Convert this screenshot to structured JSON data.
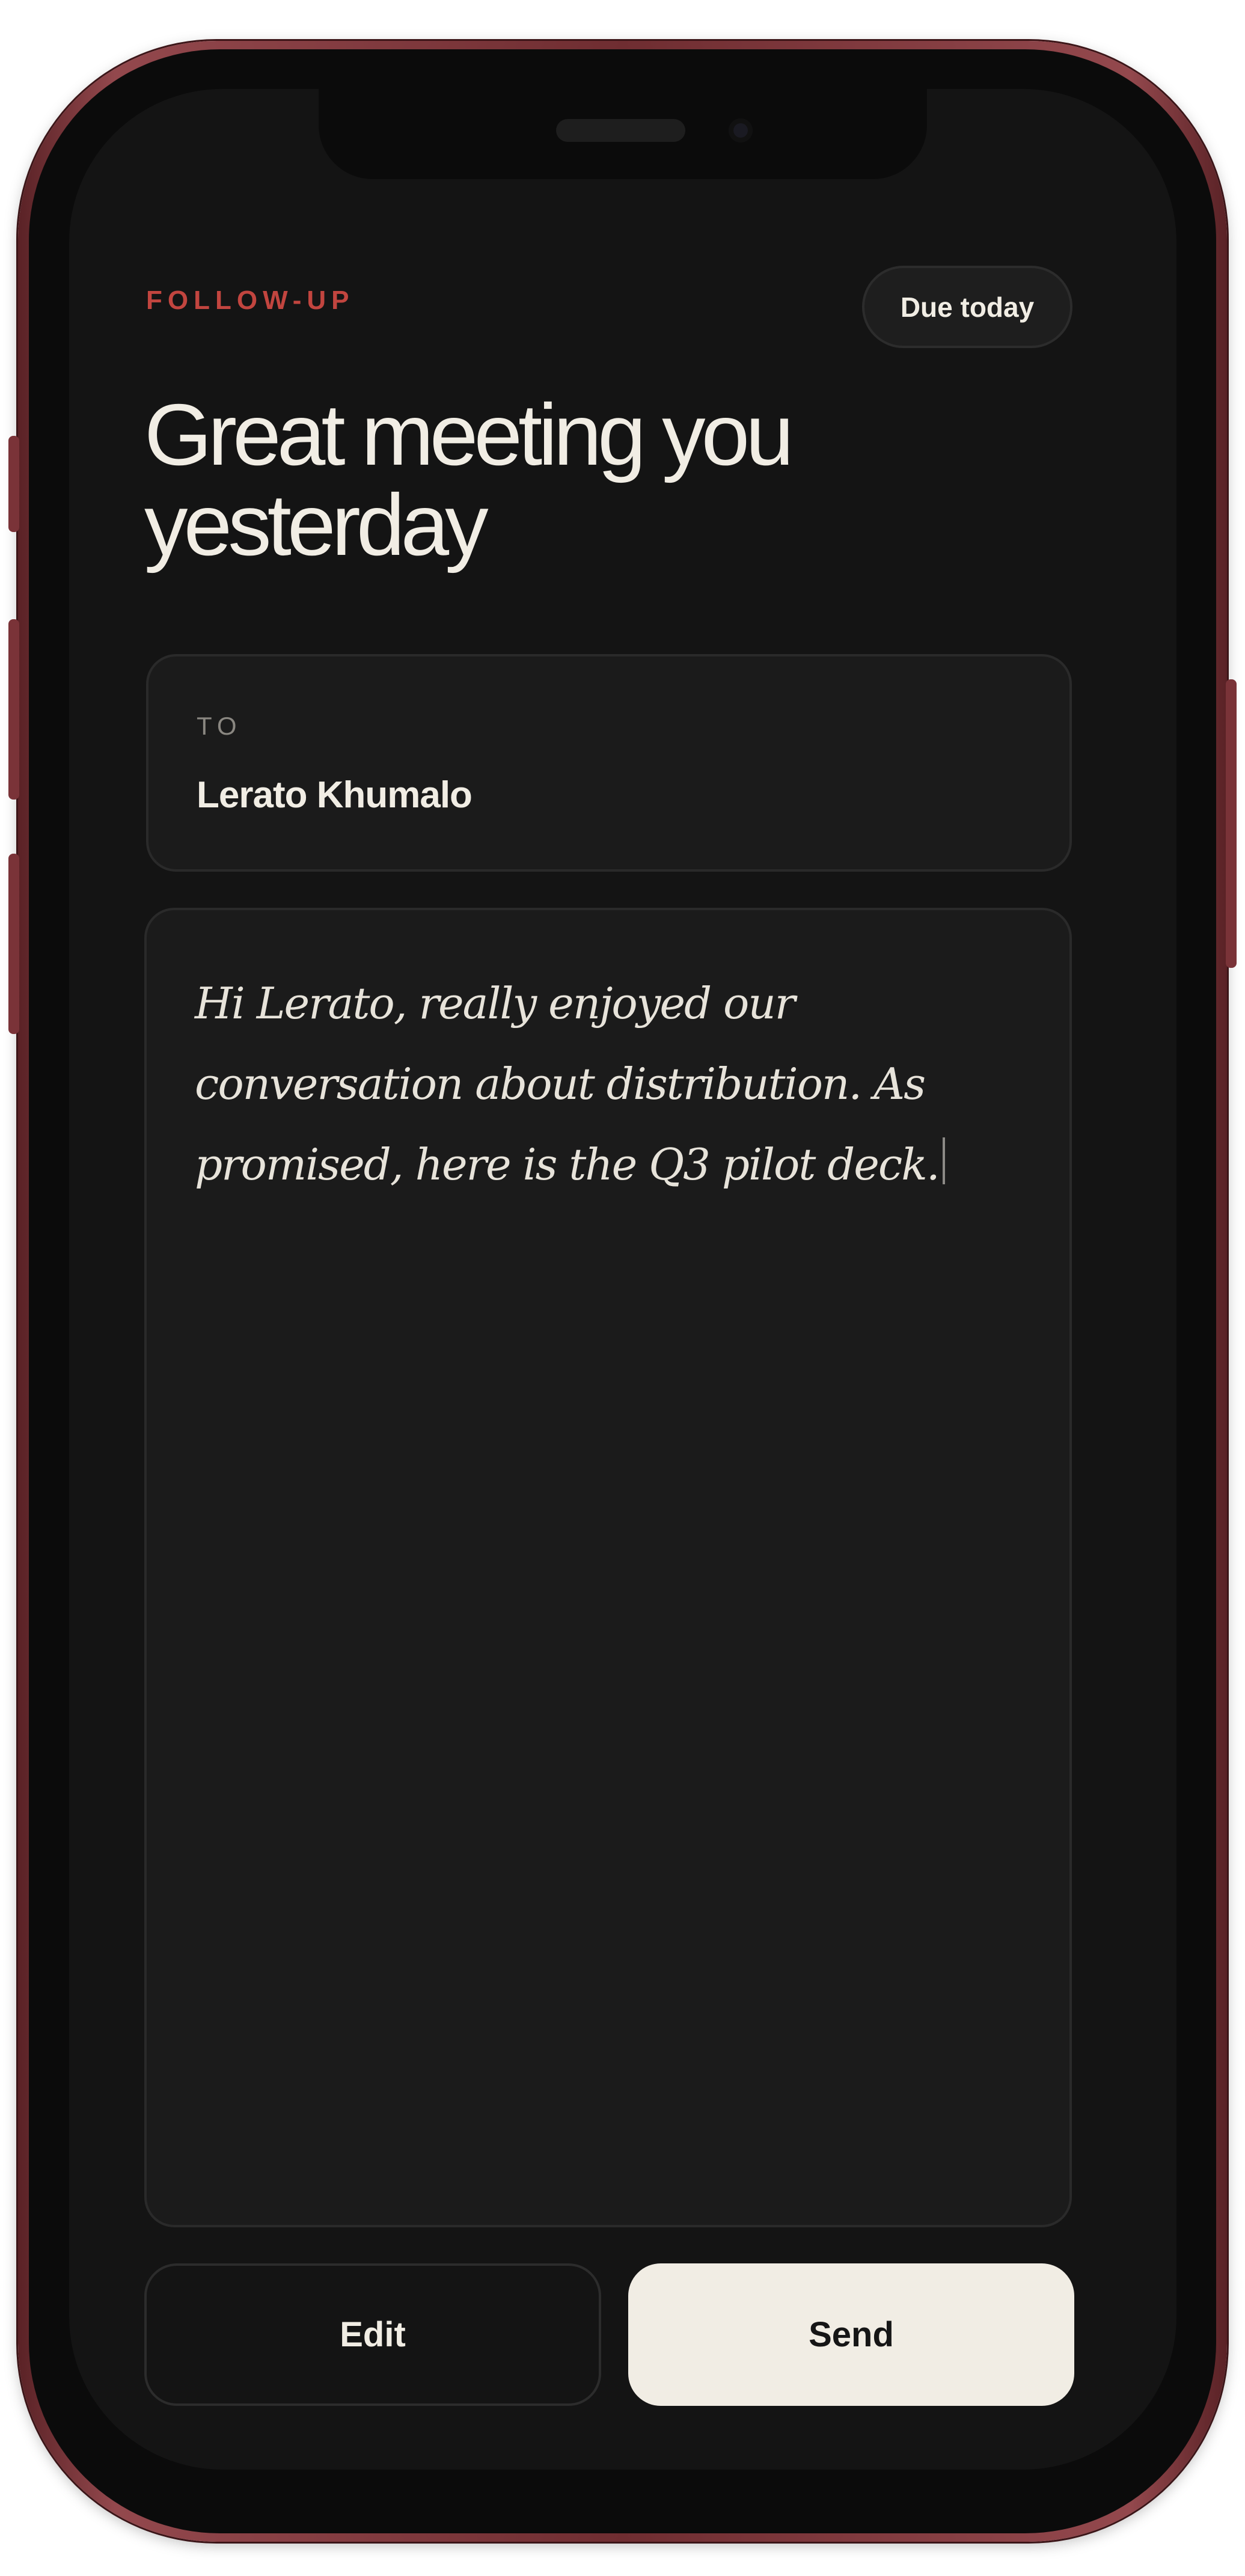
{
  "header": {
    "eyebrow": "FOLLOW-UP",
    "due_badge": "Due today",
    "title": "Great meeting you yesterday"
  },
  "recipient": {
    "label": "TO",
    "name": "Lerato Khumalo"
  },
  "message": {
    "body": "Hi Lerato, really enjoyed our conversation about distribution. As promised, here is the Q3 pilot deck."
  },
  "actions": {
    "edit_label": "Edit",
    "send_label": "Send"
  },
  "colors": {
    "accent": "#c2453f",
    "background": "#141414",
    "card": "#1b1b1b",
    "text": "#f1ede4",
    "send_button": "#f1ede4",
    "phone_frame": "#93484d"
  }
}
